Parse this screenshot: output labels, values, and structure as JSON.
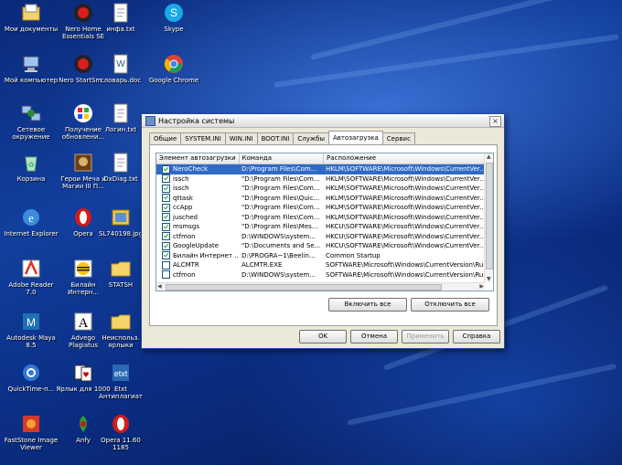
{
  "desktop": {
    "icons": [
      {
        "label": "Мои документы",
        "icon": "my-documents-icon"
      },
      {
        "label": "Nero Home Essentials SE",
        "icon": "nero-icon"
      },
      {
        "label": "инфа.txt",
        "icon": "text-file-icon"
      },
      {
        "label": "Skype",
        "icon": "skype-icon"
      },
      {
        "label": "Мой компьютер",
        "icon": "my-computer-icon"
      },
      {
        "label": "Nero StartSm...",
        "icon": "nero-icon"
      },
      {
        "label": "словарь.doc",
        "icon": "word-doc-icon"
      },
      {
        "label": "Google Chrome",
        "icon": "chrome-icon"
      },
      {
        "label": "Сетевое окружение",
        "icon": "network-icon"
      },
      {
        "label": "Получение обновлени...",
        "icon": "windows-update-icon"
      },
      {
        "label": "Логин.txt",
        "icon": "text-file-icon"
      },
      {
        "label": "Корзина",
        "icon": "recycle-bin-icon"
      },
      {
        "label": "Герои Меча и Магии III П...",
        "icon": "game-icon"
      },
      {
        "label": "DxDiag.txt",
        "icon": "text-file-icon"
      },
      {
        "label": "Internet Explorer",
        "icon": "internet-explorer-icon"
      },
      {
        "label": "Opera",
        "icon": "opera-icon"
      },
      {
        "label": "SL740198.jpg",
        "icon": "image-file-icon"
      },
      {
        "label": "Adobe Reader 7.0",
        "icon": "adobe-reader-icon"
      },
      {
        "label": "Билайн Интерн...",
        "icon": "beeline-icon"
      },
      {
        "label": "STATSH",
        "icon": "folder-icon"
      },
      {
        "label": "Autodesk Maya 8.5",
        "icon": "maya-icon"
      },
      {
        "label": "Advego Plagiatus",
        "icon": "advego-icon"
      },
      {
        "label": "Неиспольз. ярлыки",
        "icon": "folder-icon"
      },
      {
        "label": "QuickTime-п...",
        "icon": "quicktime-icon"
      },
      {
        "label": "Ярлык для 1000",
        "icon": "solitaire-icon"
      },
      {
        "label": "Etxt Антиплагиат",
        "icon": "etxt-icon"
      },
      {
        "label": "FastStone Image Viewer",
        "icon": "faststone-icon"
      },
      {
        "label": "Anfy",
        "icon": "anfy-icon"
      },
      {
        "label": "Opera 11.60 1185",
        "icon": "opera-icon"
      }
    ]
  },
  "dialog": {
    "title": "Настройка системы",
    "close_label": "×",
    "tabs": [
      {
        "label": "Общие"
      },
      {
        "label": "SYSTEM.INI"
      },
      {
        "label": "WIN.INI"
      },
      {
        "label": "BOOT.INI"
      },
      {
        "label": "Службы"
      },
      {
        "label": "Автозагрузка"
      },
      {
        "label": "Сервис"
      }
    ],
    "active_tab": "Автозагрузка",
    "columns": [
      "Элемент автозагрузки",
      "Команда",
      "Расположение"
    ],
    "rows": [
      {
        "name": "NeroCheck",
        "command": "D:\\Program Files\\Com...",
        "location": "HKLM\\SOFTWARE\\Microsoft\\Windows\\CurrentVer...",
        "checked": true,
        "selected": true
      },
      {
        "name": "issch",
        "command": "\"D:\\Program Files\\Com...",
        "location": "HKLM\\SOFTWARE\\Microsoft\\Windows\\CurrentVer...",
        "checked": true,
        "selected": false
      },
      {
        "name": "issch",
        "command": "\"D:\\Program Files\\Com...",
        "location": "HKLM\\SOFTWARE\\Microsoft\\Windows\\CurrentVer...",
        "checked": true,
        "selected": false
      },
      {
        "name": "qttask",
        "command": "\"D:\\Program Files\\Quic...",
        "location": "HKLM\\SOFTWARE\\Microsoft\\Windows\\CurrentVer...",
        "checked": true,
        "selected": false
      },
      {
        "name": "ccApp",
        "command": "\"D:\\Program Files\\Com...",
        "location": "HKLM\\SOFTWARE\\Microsoft\\Windows\\CurrentVer...",
        "checked": true,
        "selected": false
      },
      {
        "name": "jusched",
        "command": "\"D:\\Program Files\\Com...",
        "location": "HKLM\\SOFTWARE\\Microsoft\\Windows\\CurrentVer...",
        "checked": true,
        "selected": false
      },
      {
        "name": "msmsgs",
        "command": "\"D:\\Program Files\\Mes...",
        "location": "HKCU\\SOFTWARE\\Microsoft\\Windows\\CurrentVer...",
        "checked": true,
        "selected": false
      },
      {
        "name": "ctfmon",
        "command": "D:\\WINDOWS\\system...",
        "location": "HKCU\\SOFTWARE\\Microsoft\\Windows\\CurrentVer...",
        "checked": true,
        "selected": false
      },
      {
        "name": "GoogleUpdate",
        "command": "\"D:\\Documents and Se...",
        "location": "HKCU\\SOFTWARE\\Microsoft\\Windows\\CurrentVer...",
        "checked": true,
        "selected": false
      },
      {
        "name": "Билайн Интернет ...",
        "command": "D:\\PROGRA~1\\Beelin...",
        "location": "Common Startup",
        "checked": true,
        "selected": false
      },
      {
        "name": "ALCMTR",
        "command": "ALCMTR.EXE",
        "location": "SOFTWARE\\Microsoft\\Windows\\CurrentVersion\\Ru...",
        "checked": false,
        "selected": false
      },
      {
        "name": "ctfmon",
        "command": "D:\\WINDOWS\\system...",
        "location": "SOFTWARE\\Microsoft\\Windows\\CurrentVersion\\Ru...",
        "checked": false,
        "selected": false
      }
    ],
    "buttons": {
      "enable_all": "Включить все",
      "disable_all": "Отключить все",
      "ok": "OK",
      "cancel": "Отмена",
      "apply": "Применить",
      "help": "Справка"
    }
  }
}
